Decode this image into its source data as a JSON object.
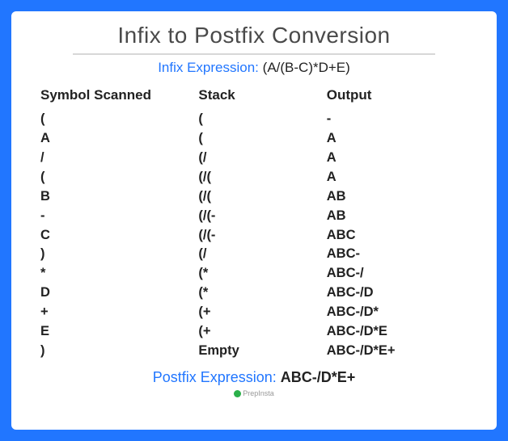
{
  "title": "Infix to Postfix Conversion",
  "infix": {
    "label": "Infix Expression:",
    "expr": "(A/(B-C)*D+E)"
  },
  "columns": {
    "c1": "Symbol Scanned",
    "c2": "Stack",
    "c3": "Output"
  },
  "rows": [
    {
      "sym": "(",
      "stack": "(",
      "out": "-",
      "is_dash": true
    },
    {
      "sym": "A",
      "stack": "(",
      "out": "A"
    },
    {
      "sym": "/",
      "stack": "(/",
      "out": "A"
    },
    {
      "sym": "(",
      "stack": "(/(",
      "out": "A"
    },
    {
      "sym": "B",
      "stack": "(/(",
      "out": "AB"
    },
    {
      "sym": "-",
      "stack": "(/(-",
      "out": "AB"
    },
    {
      "sym": "C",
      "stack": "(/(-",
      "out": "ABC"
    },
    {
      "sym": ")",
      "stack": "(/",
      "out": "ABC-"
    },
    {
      "sym": "*",
      "stack": "(*",
      "out": "ABC-/"
    },
    {
      "sym": "D",
      "stack": "(*",
      "out": "ABC-/D"
    },
    {
      "sym": "+",
      "stack": "(+",
      "out": "ABC-/D*"
    },
    {
      "sym": "E",
      "stack": "(+",
      "out": "ABC-/D*E"
    },
    {
      "sym": ")",
      "stack": "Empty",
      "out": "ABC-/D*E+",
      "is_empty": true
    }
  ],
  "postfix": {
    "label": "Postfix Expression:",
    "expr": "ABC-/D*E+"
  },
  "brand": "PrepInsta"
}
